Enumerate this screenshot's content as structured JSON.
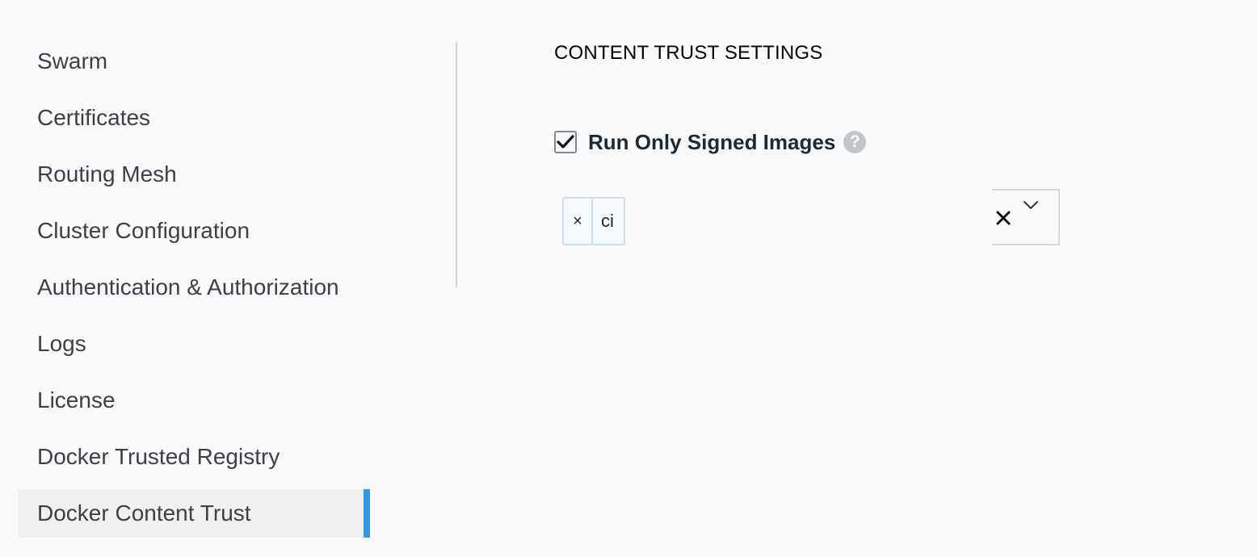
{
  "sidebar": {
    "items": [
      {
        "label": "Swarm",
        "active": false
      },
      {
        "label": "Certificates",
        "active": false
      },
      {
        "label": "Routing Mesh",
        "active": false
      },
      {
        "label": "Cluster Configuration",
        "active": false
      },
      {
        "label": "Authentication & Authorization",
        "active": false
      },
      {
        "label": "Logs",
        "active": false
      },
      {
        "label": "License",
        "active": false
      },
      {
        "label": "Docker Trusted Registry",
        "active": false
      },
      {
        "label": "Docker Content Trust",
        "active": true
      }
    ]
  },
  "main": {
    "section_title": "CONTENT TRUST SETTINGS",
    "run_signed": {
      "label": "Run Only Signed Images",
      "checked": true,
      "help_glyph": "?"
    },
    "team_select": {
      "tags": [
        {
          "remove_glyph": "×",
          "label": "ci"
        }
      ],
      "clear_icon": "close-icon",
      "dropdown_icon": "chevron-down-icon"
    }
  },
  "colors": {
    "accent": "#2e9be4",
    "tag_border": "#c8dff5",
    "help_icon_bg": "#c1c6cb",
    "text_dark": "#1c2a36"
  }
}
